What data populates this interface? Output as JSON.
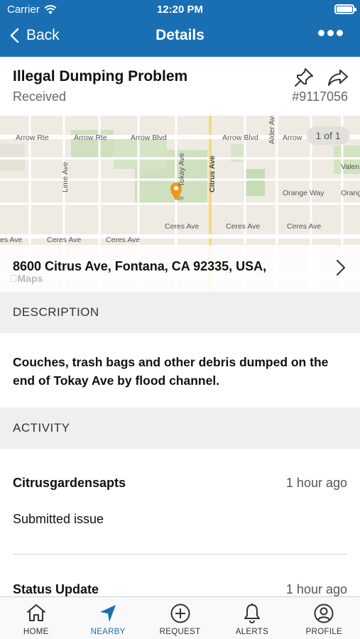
{
  "status_bar": {
    "carrier": "Carrier",
    "time": "12:20 PM"
  },
  "nav": {
    "back_label": "Back",
    "title": "Details"
  },
  "issue": {
    "title": "Illegal Dumping Problem",
    "status": "Received",
    "ticket": "#9117056"
  },
  "map": {
    "counter": "1 of 1",
    "address": "8600 Citrus Ave, Fontana, CA 92335, USA,",
    "logo": "Maps",
    "streets": {
      "arrow_rte_1": "Arrow Rte",
      "arrow_rte_2": "Arrow Rte",
      "arrow_blvd_1": "Arrow Blvd",
      "arrow_blvd_2": "Arrow Blvd",
      "arrow_3": "Arrow",
      "lime_ave": "Lime Ave",
      "tokay_ave": "Tokay Ave",
      "citrus_ave": "Citrus Ave",
      "alder_ave": "Alder Ave",
      "valencia": "Valen",
      "orange_way": "Orange Way",
      "orange_2": "Orang",
      "ceres_1": "es Ave",
      "ceres_2": "Ceres Ave",
      "ceres_3": "Ceres Ave",
      "ceres_4": "Ceres Ave",
      "ceres_5": "Ceres Ave",
      "ceres_6": "Ceres Ave"
    },
    "pin_color": "#f0961e"
  },
  "description": {
    "header": "DESCRIPTION",
    "text": "Couches, trash bags and other debris dumped on the end of Tokay Ave by flood channel."
  },
  "activity": {
    "header": "ACTIVITY",
    "items": [
      {
        "user": "Citrusgardensapts",
        "time": "1 hour ago",
        "text": "Submitted issue"
      },
      {
        "user": "Status Update",
        "time": "1 hour ago"
      }
    ]
  },
  "tabs": [
    {
      "label": "HOME",
      "icon": "home-icon",
      "active": false
    },
    {
      "label": "NEARBY",
      "icon": "nearby-arrow-icon",
      "active": true
    },
    {
      "label": "REQUEST",
      "icon": "plus-circle-icon",
      "active": false
    },
    {
      "label": "ALERTS",
      "icon": "bell-icon",
      "active": false
    },
    {
      "label": "PROFILE",
      "icon": "user-circle-icon",
      "active": false
    }
  ],
  "colors": {
    "brand": "#1a6fb3",
    "section_bg": "#efefef"
  }
}
